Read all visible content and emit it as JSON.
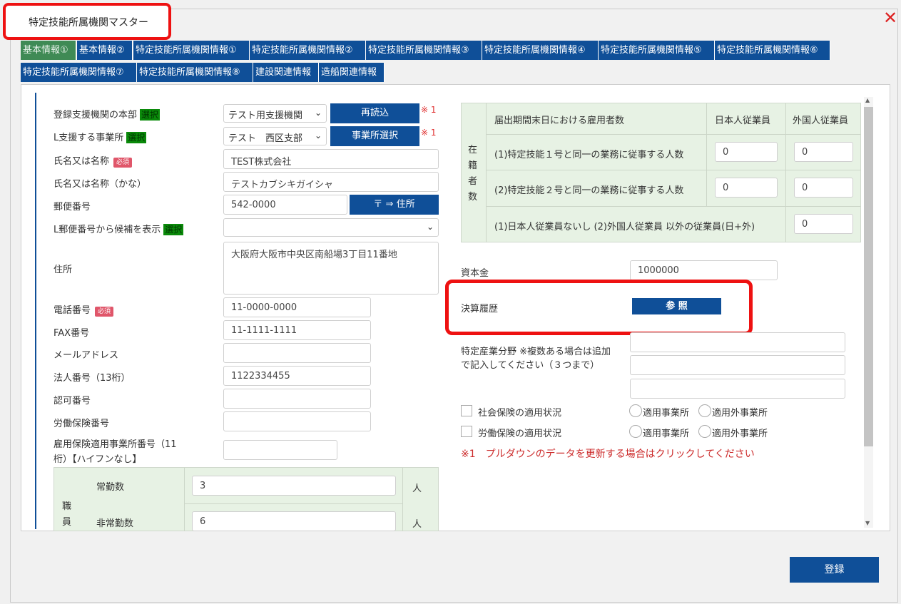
{
  "dialog": {
    "title": "特定技能所属機関マスター",
    "close": "✕"
  },
  "tabs": [
    "基本情報①",
    "基本情報②",
    "特定技能所属機関情報①",
    "特定技能所属機関情報②",
    "特定技能所属機関情報③",
    "特定技能所属機関情報④",
    "特定技能所属機関情報⑤",
    "特定技能所属機関情報⑥",
    "特定技能所属機関情報⑦",
    "特定技能所属機関情報⑧",
    "建設関連情報",
    "造船関連情報"
  ],
  "left": {
    "honbu_label": "登録支援機関の本部",
    "select_badge": "選択",
    "honbu_value": "テスト用支援機関",
    "reload_btn": "再読込",
    "note_mark": "※ 1",
    "jigyosho_label": "L支援する事業所",
    "jigyosho_value": "テスト　西区支部",
    "jigyosho_btn": "事業所選択",
    "name_label": "氏名又は名称",
    "required": "必須",
    "name_value": "TEST株式会社",
    "kana_label": "氏名又は名称（かな）",
    "kana_value": "テストカブシキガイシャ",
    "postal_label": "郵便番号",
    "postal_value": "542-0000",
    "postal_btn": "〒 ⇒ 住所",
    "postal_cand_label": "L郵便番号から候補を表示",
    "address_label": "住所",
    "address_value": "大阪府大阪市中央区南船場3丁目11番地",
    "tel_label": "電話番号",
    "tel_value": "11-0000-0000",
    "fax_label": "FAX番号",
    "fax_value": "11-1111-1111",
    "mail_label": "メールアドレス",
    "corp_label": "法人番号（13桁）",
    "corp_value": "1122334455",
    "permit_label": "認可番号",
    "labor_label": "労働保険番号",
    "employ_label_1": "雇用保険適用事業所番号（11",
    "employ_label_2": "桁）【ハイフンなし】",
    "staff_head": "職員",
    "fulltime_label": "常勤数",
    "fulltime_value": "3",
    "parttime_label": "非常勤数",
    "parttime_value": "6",
    "unit": "人"
  },
  "right": {
    "table_side": "在籍者数",
    "table_head": "届出期間末日における雇用者数",
    "col_jp": "日本人従業員",
    "col_foreign": "外国人従業員",
    "row1": "(1)特定技能１号と同一の業務に従事する人数",
    "row2": "(2)特定技能２号と同一の業務に従事する人数",
    "row3": "(1)日本人従業員ないし (2)外国人従業員 以外の従業員(日+外)",
    "row1_jp": "0",
    "row1_fr": "0",
    "row2_jp": "0",
    "row2_fr": "0",
    "row3_val": "0",
    "capital_label": "資本金",
    "capital_value": "1000000",
    "kessan_label": "決算履歴",
    "kessan_btn": "参 照",
    "industry_label": "特定産業分野 ※複数ある場合は追加で記入してください（３つまで）",
    "social_label": "社会保険の適用状況",
    "labor_ins_label": "労働保険の適用状況",
    "applied": "適用事業所",
    "not_applied": "適用外事業所",
    "pulldown_note": "※1　プルダウンのデータを更新する場合はクリックしてください"
  },
  "footer": {
    "register": "登録"
  }
}
